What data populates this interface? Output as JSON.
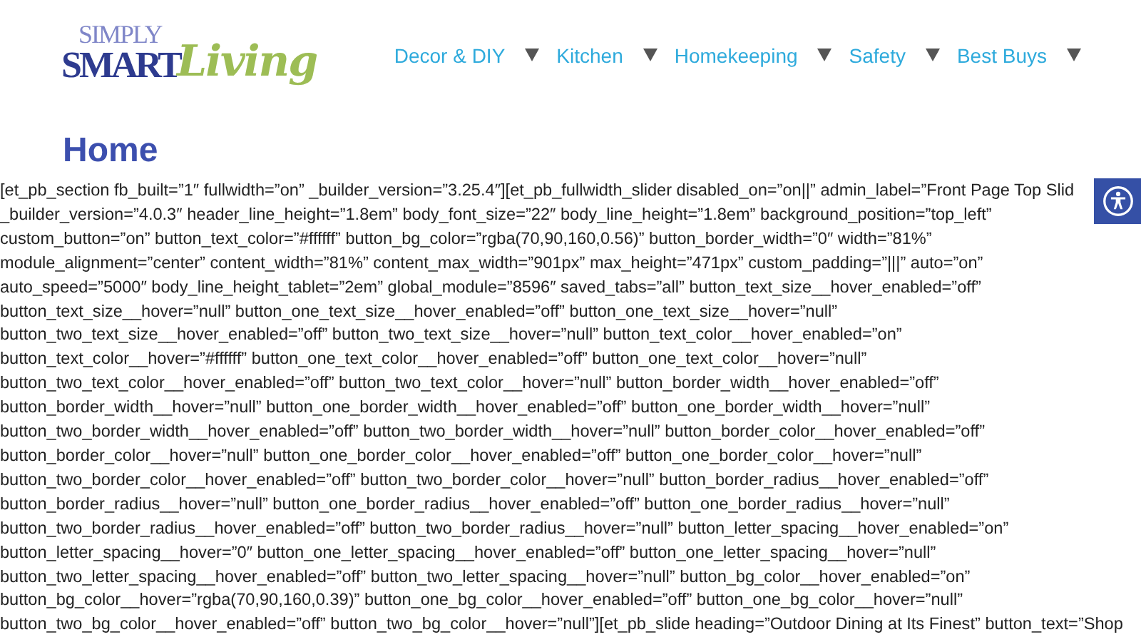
{
  "logo": {
    "top": "SIMPLY",
    "main": "SMART",
    "script": "Living"
  },
  "nav": [
    {
      "label": "Decor & DIY"
    },
    {
      "label": "Kitchen"
    },
    {
      "label": "Homekeeping"
    },
    {
      "label": "Safety"
    },
    {
      "label": "Best Buys"
    }
  ],
  "page_title": "Home",
  "content_lines": [
    "[et_pb_section fb_built=”1″ fullwidth=”on” _builder_version=”3.25.4″][et_pb_fullwidth_slider disabled_on=”on||” admin_label=”Front Page Top Slid",
    "_builder_version=”4.0.3″ header_line_height=”1.8em” body_font_size=”22″ body_line_height=”1.8em” background_position=”top_left”",
    "custom_button=”on” button_text_color=”#ffffff” button_bg_color=”rgba(70,90,160,0.56)” button_border_width=”0″ width=”81%”",
    "module_alignment=”center” content_width=”81%” content_max_width=”901px” max_height=”471px” custom_padding=”|||” auto=”on”",
    "auto_speed=”5000″ body_line_height_tablet=”2em” global_module=”8596″ saved_tabs=”all” button_text_size__hover_enabled=”off”",
    "button_text_size__hover=”null” button_one_text_size__hover_enabled=”off” button_one_text_size__hover=”null”",
    "button_two_text_size__hover_enabled=”off” button_two_text_size__hover=”null” button_text_color__hover_enabled=”on”",
    "button_text_color__hover=”#ffffff” button_one_text_color__hover_enabled=”off” button_one_text_color__hover=”null”",
    "button_two_text_color__hover_enabled=”off” button_two_text_color__hover=”null” button_border_width__hover_enabled=”off”",
    "button_border_width__hover=”null” button_one_border_width__hover_enabled=”off” button_one_border_width__hover=”null”",
    "button_two_border_width__hover_enabled=”off” button_two_border_width__hover=”null” button_border_color__hover_enabled=”off”",
    "button_border_color__hover=”null” button_one_border_color__hover_enabled=”off” button_one_border_color__hover=”null”",
    "button_two_border_color__hover_enabled=”off” button_two_border_color__hover=”null” button_border_radius__hover_enabled=”off”",
    "button_border_radius__hover=”null” button_one_border_radius__hover_enabled=”off” button_one_border_radius__hover=”null”",
    "button_two_border_radius__hover_enabled=”off” button_two_border_radius__hover=”null” button_letter_spacing__hover_enabled=”on”",
    "button_letter_spacing__hover=”0″ button_one_letter_spacing__hover_enabled=”off” button_one_letter_spacing__hover=”null”",
    "button_two_letter_spacing__hover_enabled=”off” button_two_letter_spacing__hover=”null” button_bg_color__hover_enabled=”on”",
    "button_bg_color__hover=”rgba(70,90,160,0.39)” button_one_bg_color__hover_enabled=”off” button_one_bg_color__hover=”null”",
    "button_two_bg_color__hover_enabled=”off” button_two_bg_color__hover=”null”][et_pb_slide heading=”Outdoor Dining at Its Finest” button_text=”Shop"
  ]
}
